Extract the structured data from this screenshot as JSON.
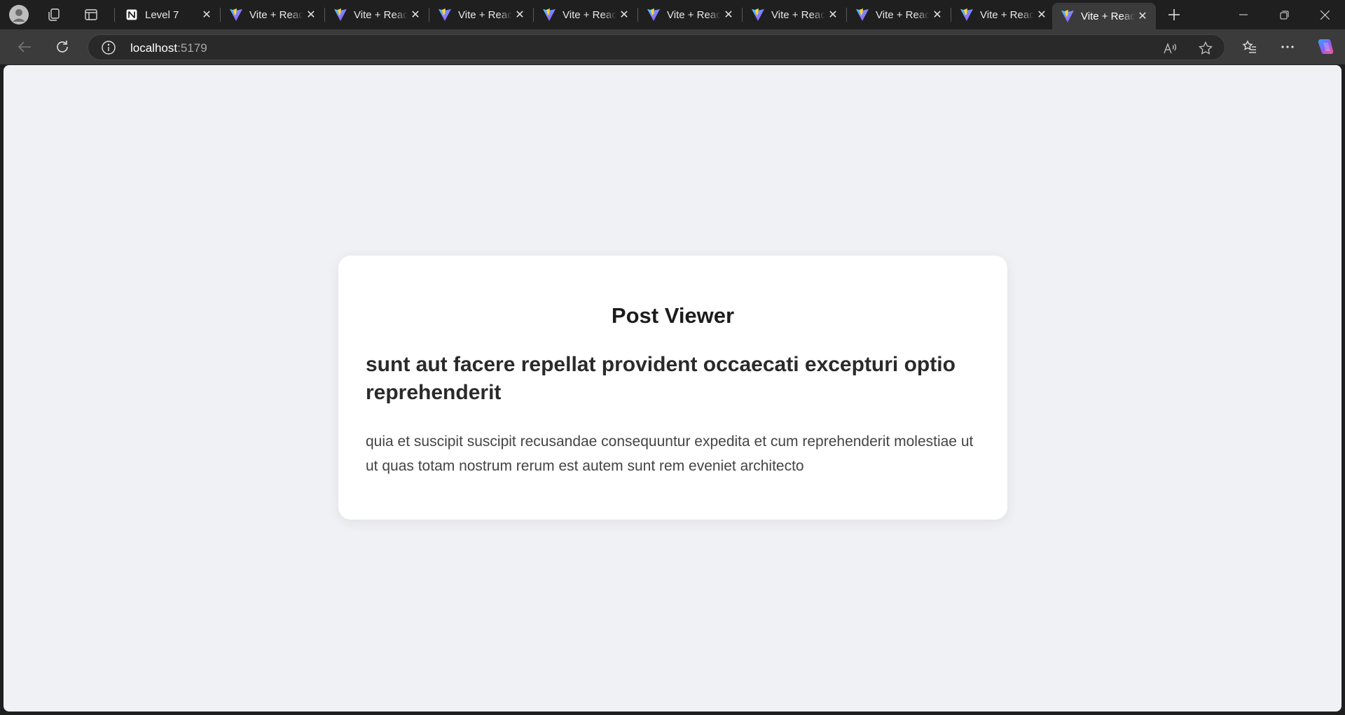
{
  "browser": {
    "tabs": [
      {
        "title": "Level 7",
        "favicon": "notion-icon",
        "active": false
      },
      {
        "title": "Vite + React",
        "favicon": "vite-icon",
        "active": false
      },
      {
        "title": "Vite + React",
        "favicon": "vite-icon",
        "active": false
      },
      {
        "title": "Vite + React",
        "favicon": "vite-icon",
        "active": false
      },
      {
        "title": "Vite + React",
        "favicon": "vite-icon",
        "active": false
      },
      {
        "title": "Vite + React",
        "favicon": "vite-icon",
        "active": false
      },
      {
        "title": "Vite + React",
        "favicon": "vite-icon",
        "active": false
      },
      {
        "title": "Vite + React",
        "favicon": "vite-icon",
        "active": false
      },
      {
        "title": "Vite + React",
        "favicon": "vite-icon",
        "active": false
      },
      {
        "title": "Vite + React",
        "favicon": "vite-icon",
        "active": true
      }
    ],
    "address": {
      "host": "localhost",
      "port": ":5179"
    },
    "colors": {
      "chrome_dark": "#1f1f1f",
      "toolbar": "#3b3b3b",
      "page_bg": "#f0f1f5"
    }
  },
  "page": {
    "heading": "Post Viewer",
    "post": {
      "title": "sunt aut facere repellat provident occaecati excepturi optio reprehenderit",
      "body": "quia et suscipit suscipit recusandae consequuntur expedita et cum reprehenderit molestiae ut ut quas totam nostrum rerum est autem sunt rem eveniet architecto"
    }
  }
}
